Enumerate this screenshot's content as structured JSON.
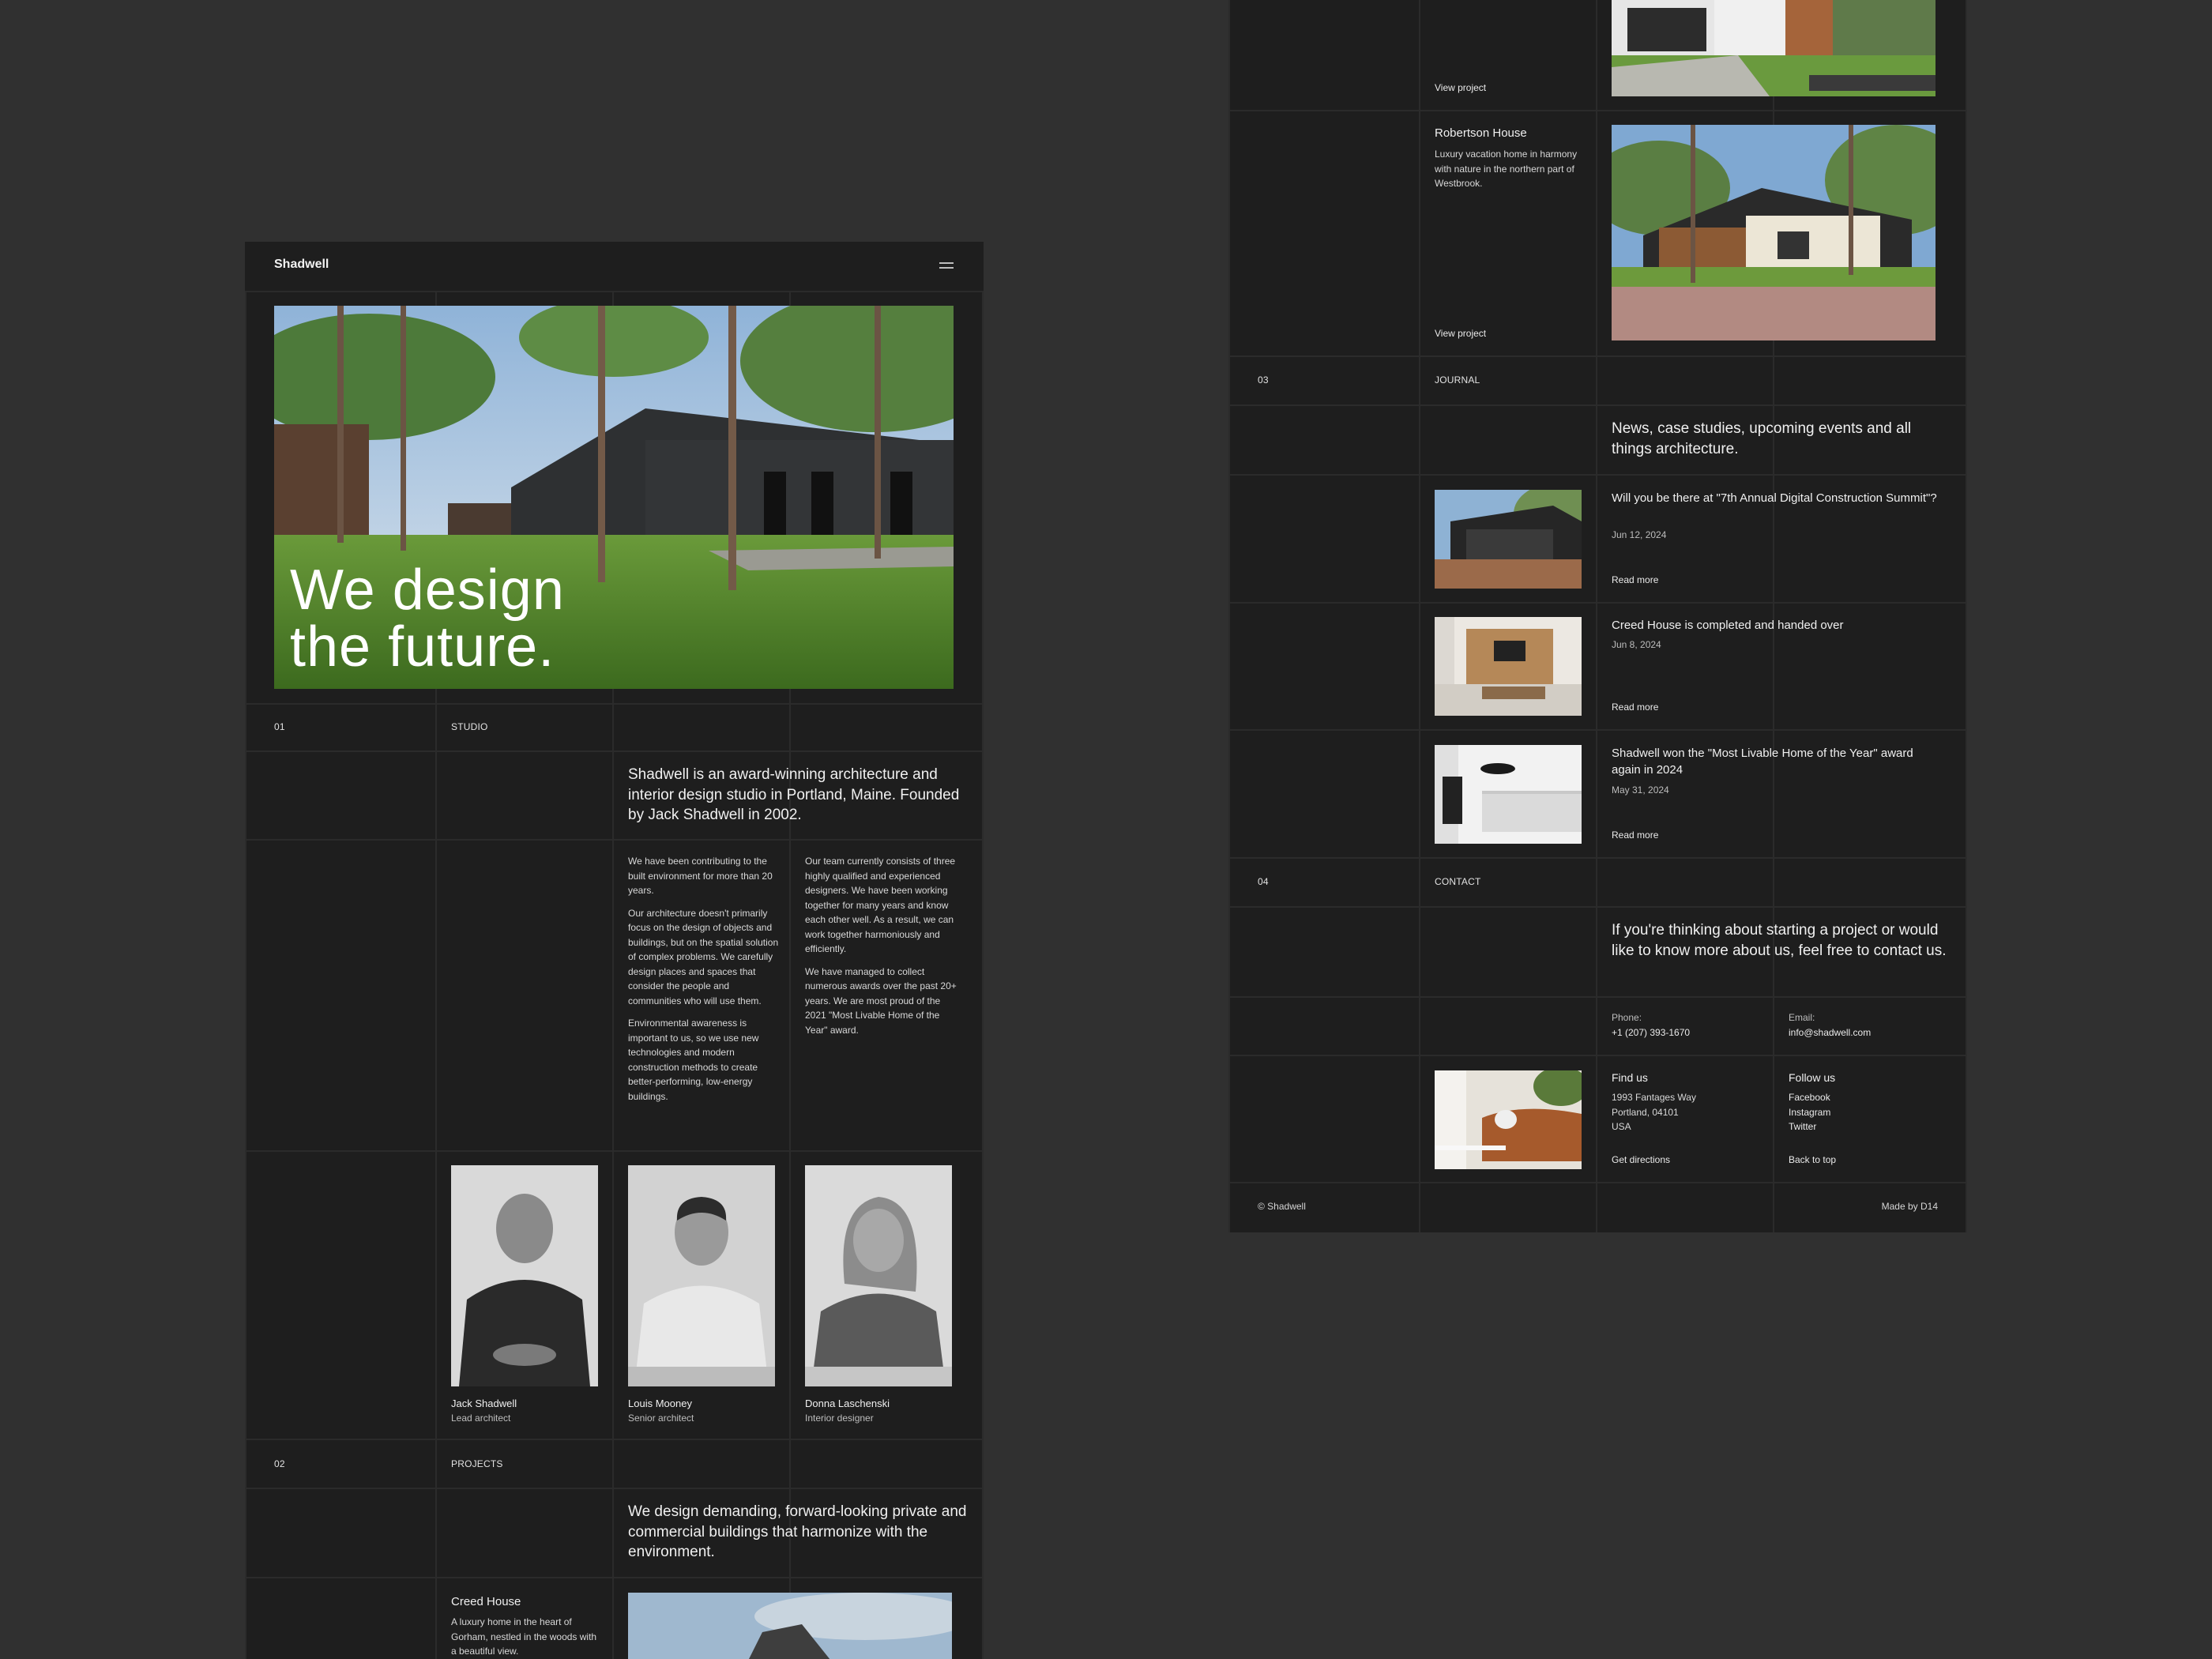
{
  "header": {
    "brand": "Shadwell"
  },
  "hero": {
    "line1": "We design",
    "line2": "the future."
  },
  "studio": {
    "number": "01",
    "label": "STUDIO",
    "lead": "Shadwell is an award-winning architecture and interior design studio in Portland, Maine. Founded by Jack Shadwell in 2002.",
    "col1": [
      "We have been contributing to the built environment for more than 20 years.",
      "Our architecture doesn't primarily focus on the design of objects and buildings, but on the spatial solution of complex problems. We carefully design places and spaces that consider the people and communities who will use them.",
      "Environmental awareness is important to us, so we use new technologies and modern construction methods to create better-performing, low-energy buildings."
    ],
    "col2": [
      "Our team currently consists of three highly qualified and experienced designers. We have been working together for many years and know each other well. As a result, we can work together harmoniously and efficiently.",
      "We have managed to collect numerous awards over the past 20+ years. We are most proud of the 2021 \"Most Livable Home of the Year\" award."
    ],
    "team": [
      {
        "name": "Jack Shadwell",
        "role": "Lead architect"
      },
      {
        "name": "Louis Mooney",
        "role": "Senior architect"
      },
      {
        "name": "Donna Laschenski",
        "role": "Interior designer"
      }
    ]
  },
  "projects": {
    "number": "02",
    "label": "PROJECTS",
    "lead": "We design demanding, forward-looking private and commercial buildings that harmonize with the environment.",
    "items": [
      {
        "title": "Creed House",
        "desc": "A luxury home in the heart of Gorham, nestled in the woods with a beautiful view."
      },
      {
        "title": "Robertson House",
        "desc": "Luxury vacation home in harmony with nature in the northern part of Westbrook.",
        "link": "View project"
      }
    ],
    "prev_link": "View project"
  },
  "journal": {
    "number": "03",
    "label": "JOURNAL",
    "lead": "News, case studies, upcoming events and all things architecture.",
    "items": [
      {
        "title": "Will you be there at \"7th Annual Digital Construction Summit\"?",
        "date": "Jun 12, 2024",
        "link": "Read more"
      },
      {
        "title": "Creed House is completed and handed over",
        "date": "Jun 8, 2024",
        "link": "Read more"
      },
      {
        "title": "Shadwell won the \"Most Livable Home of the Year\" award again in 2024",
        "date": "May 31, 2024",
        "link": "Read more"
      }
    ]
  },
  "contact": {
    "number": "04",
    "label": "CONTACT",
    "lead": "If you're thinking about starting a project or would like to know more about us, feel free to contact us.",
    "phone_label": "Phone:",
    "phone": "+1 (207) 393-1670",
    "email_label": "Email:",
    "email": "info@shadwell.com",
    "find_title": "Find us",
    "address": [
      "1993 Fantages Way",
      "Portland, 04101",
      "USA"
    ],
    "directions": "Get directions",
    "follow_title": "Follow us",
    "social": [
      "Facebook",
      "Instagram",
      "Twitter"
    ],
    "back_to_top": "Back to top"
  },
  "footer": {
    "copyright": "© Shadwell",
    "credit": "Made by D14"
  }
}
